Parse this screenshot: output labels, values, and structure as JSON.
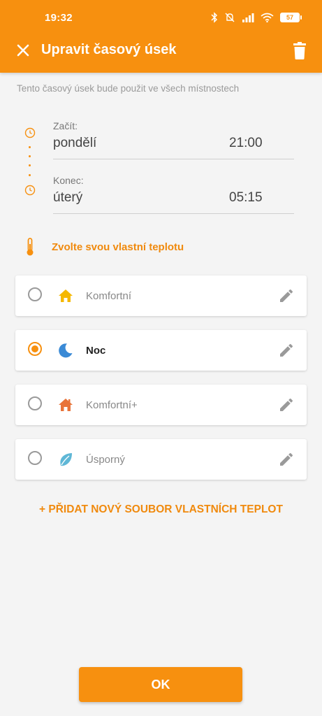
{
  "status_bar": {
    "time": "19:32",
    "battery": "57"
  },
  "toolbar": {
    "title": "Upravit časový úsek"
  },
  "subtitle": "Tento časový úsek bude použit ve všech místnostech",
  "schedule": {
    "start": {
      "label": "Začít:",
      "day": "pondělí",
      "time": "21:00"
    },
    "end": {
      "label": "Konec:",
      "day": "úterý",
      "time": "05:15"
    }
  },
  "custom_temperature": {
    "label": "Zvolte svou vlastní teplotu"
  },
  "modes": [
    {
      "label": "Komfortní",
      "icon": "house-icon",
      "color": "#f5b800",
      "selected": false
    },
    {
      "label": "Noc",
      "icon": "moon-icon",
      "color": "#3a8ad6",
      "selected": true
    },
    {
      "label": "Komfortní+",
      "icon": "house-plus-icon",
      "color": "#e8743a",
      "selected": false
    },
    {
      "label": "Úsporný",
      "icon": "leaf-icon",
      "color": "#5fb7d6",
      "selected": false
    }
  ],
  "add_link": "+ PŘIDAT NOVÝ SOUBOR VLASTNÍCH TEPLOT",
  "ok_button": "OK",
  "colors": {
    "accent": "#f7900f",
    "background": "#f4f4f4"
  }
}
